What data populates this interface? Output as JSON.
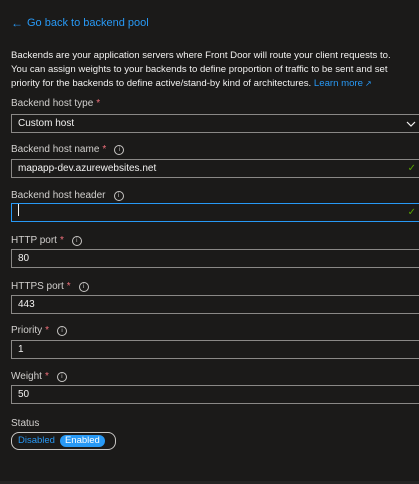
{
  "nav": {
    "back_label": "Go back to backend pool"
  },
  "description": {
    "text": "Backends are your application servers where Front Door will route your client requests to. You can assign weights to your backends to define proportion of traffic to be sent and set priority for the backends to define active/stand-by kind of architectures.",
    "learn_more": "Learn more"
  },
  "fields": {
    "host_type": {
      "label": "Backend host type",
      "required": "*",
      "value": "Custom host"
    },
    "host_name": {
      "label": "Backend host name",
      "required": "*",
      "value": "mapapp-dev.azurewebsites.net"
    },
    "host_header": {
      "label": "Backend host header",
      "value": ""
    },
    "http_port": {
      "label": "HTTP port",
      "required": "*",
      "value": "80"
    },
    "https_port": {
      "label": "HTTPS port",
      "required": "*",
      "value": "443"
    },
    "priority": {
      "label": "Priority",
      "required": "*",
      "value": "1"
    },
    "weight": {
      "label": "Weight",
      "required": "*",
      "value": "50"
    }
  },
  "status": {
    "label": "Status",
    "options": [
      "Disabled",
      "Enabled"
    ],
    "selected": "Enabled"
  },
  "colors": {
    "background": "#1b1a19",
    "accent": "#2899f5",
    "required": "#f1707b",
    "valid": "#57a300",
    "border": "#8a8886"
  },
  "icons": {
    "back": "arrow-left-icon",
    "info": "info-icon",
    "valid": "checkmark-icon",
    "dropdown": "chevron-down-icon",
    "external": "external-link-icon"
  }
}
